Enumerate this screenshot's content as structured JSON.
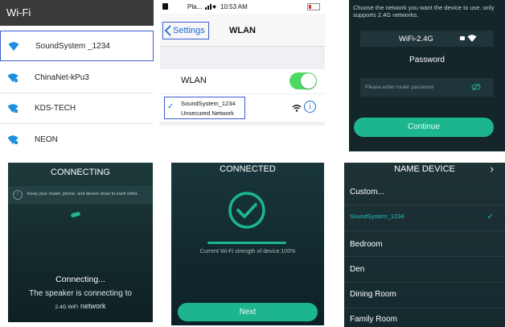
{
  "android_wifi": {
    "title": "Wi-Fi",
    "networks": [
      "SoundSystem _1234",
      "ChinaNet-kPu3",
      "KDS-TECH",
      "NEON"
    ],
    "accent_color": "#3d5bd0",
    "icon_color": "#1e8fe0"
  },
  "ios_wlan": {
    "carrier": "Pla...",
    "time": "10:53 AM",
    "back_label": "Settings",
    "title": "WLAN",
    "wlan_label": "WLAN",
    "wlan_on": true,
    "network_name": "SoundSystem_1234",
    "network_status": "Unsecured Network",
    "toggle_color": "#4cd964",
    "link_color": "#1a6ad6"
  },
  "router_password": {
    "note": "Choose the network you want the device to use. only supports 2.4G networks.",
    "network": "WiFi-2.4G",
    "password_label": "Password",
    "password_placeholder": "Please enter router password",
    "continue_label": "Continue",
    "button_color": "#1db58e"
  },
  "connecting": {
    "title": "CONNECTING",
    "info": "Keep your router, phone, and device close to each other.",
    "status": "Connecting...",
    "line1": "The speaker is connecting to",
    "line2_small": "2.4G WiFi",
    "line2_rest": " network"
  },
  "connected": {
    "title": "CONNECTED",
    "strength_text": "Current Wi-Fi strength of device:100%",
    "next_label": "Next",
    "accent_color": "#1db58e"
  },
  "name_device": {
    "title": "NAME DEVICE",
    "next_arrow": "›",
    "items": [
      "Custom...",
      "SoundSystem_1234",
      "Bedroom",
      "Den",
      "Dining Room",
      "Family Room"
    ],
    "selected_index": 1,
    "selected_color": "#1ec6c6"
  }
}
